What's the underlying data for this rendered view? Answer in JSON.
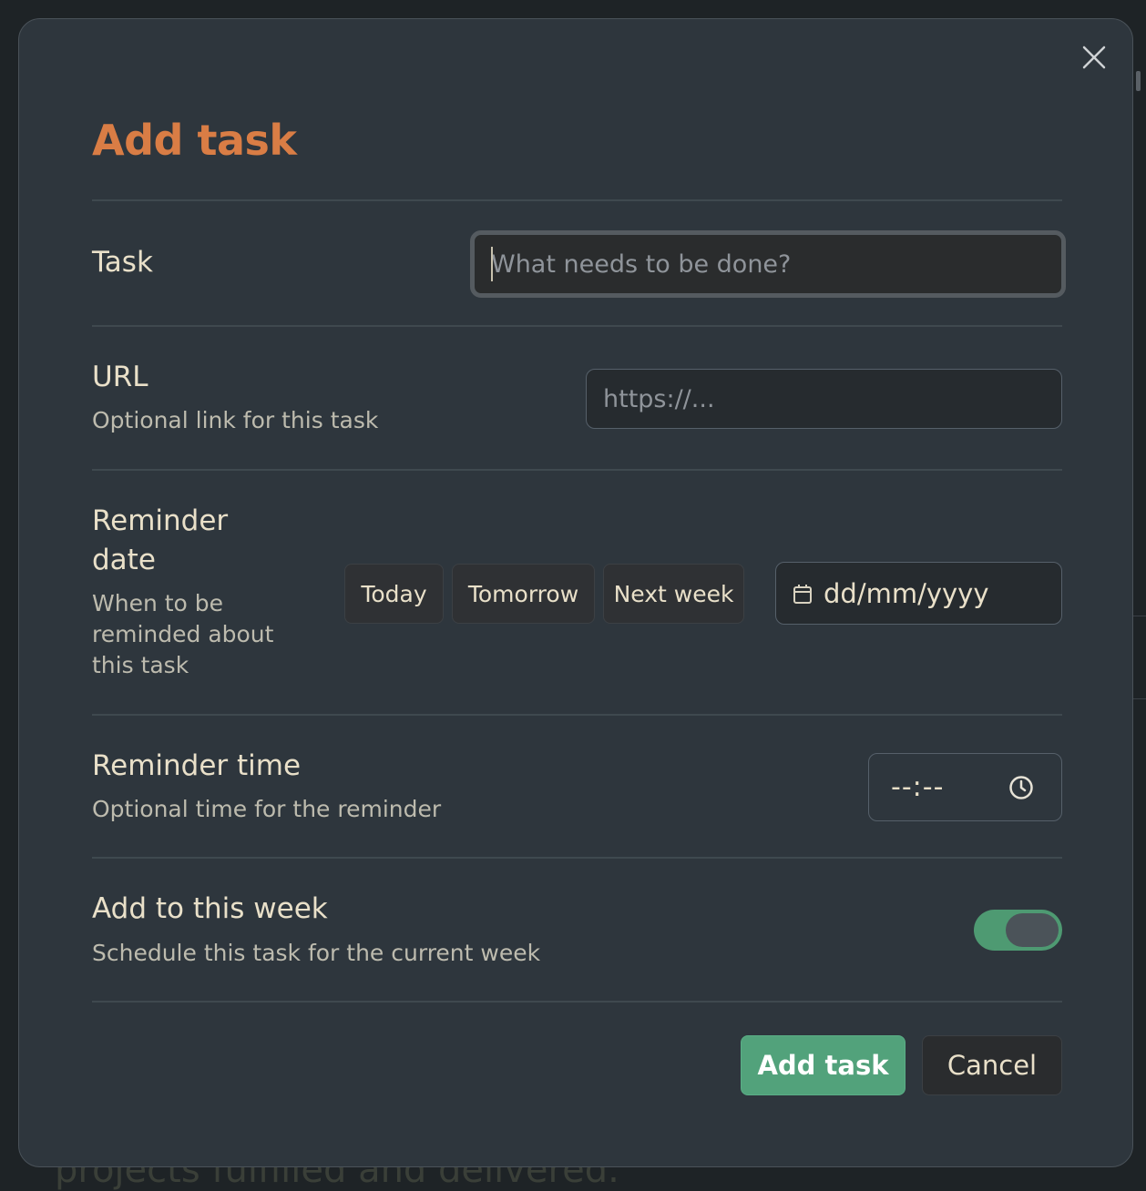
{
  "background": {
    "partial_text": "projects fulfilled and delivered."
  },
  "modal": {
    "title": "Add task",
    "close_icon": "close-icon",
    "fields": {
      "task": {
        "label": "Task",
        "placeholder": "What needs to be done?",
        "value": ""
      },
      "url": {
        "label": "URL",
        "description": "Optional link for this task",
        "placeholder": "https://...",
        "value": ""
      },
      "reminder_date": {
        "label_line1": "Reminder",
        "label_line2": "date",
        "description_line1": "When to be",
        "description_line2": "reminded about",
        "description_line3": "this task",
        "quick_options": [
          "Today",
          "Tomorrow",
          "Next week"
        ],
        "date_placeholder": "dd/mm/yyyy",
        "calendar_icon": "calendar-icon"
      },
      "reminder_time": {
        "label": "Reminder time",
        "description": "Optional time for the reminder",
        "time_placeholder": "--:--",
        "clock_icon": "clock-icon"
      },
      "this_week": {
        "label": "Add to this week",
        "description": "Schedule this task for the current week",
        "enabled": true
      }
    },
    "actions": {
      "submit_label": "Add task",
      "cancel_label": "Cancel"
    }
  },
  "colors": {
    "modal_bg": "#2e363d",
    "title_accent": "#d97d45",
    "primary_button": "#52a27b",
    "toggle_on": "#4e9a72",
    "label_text": "#e9e0c9"
  }
}
